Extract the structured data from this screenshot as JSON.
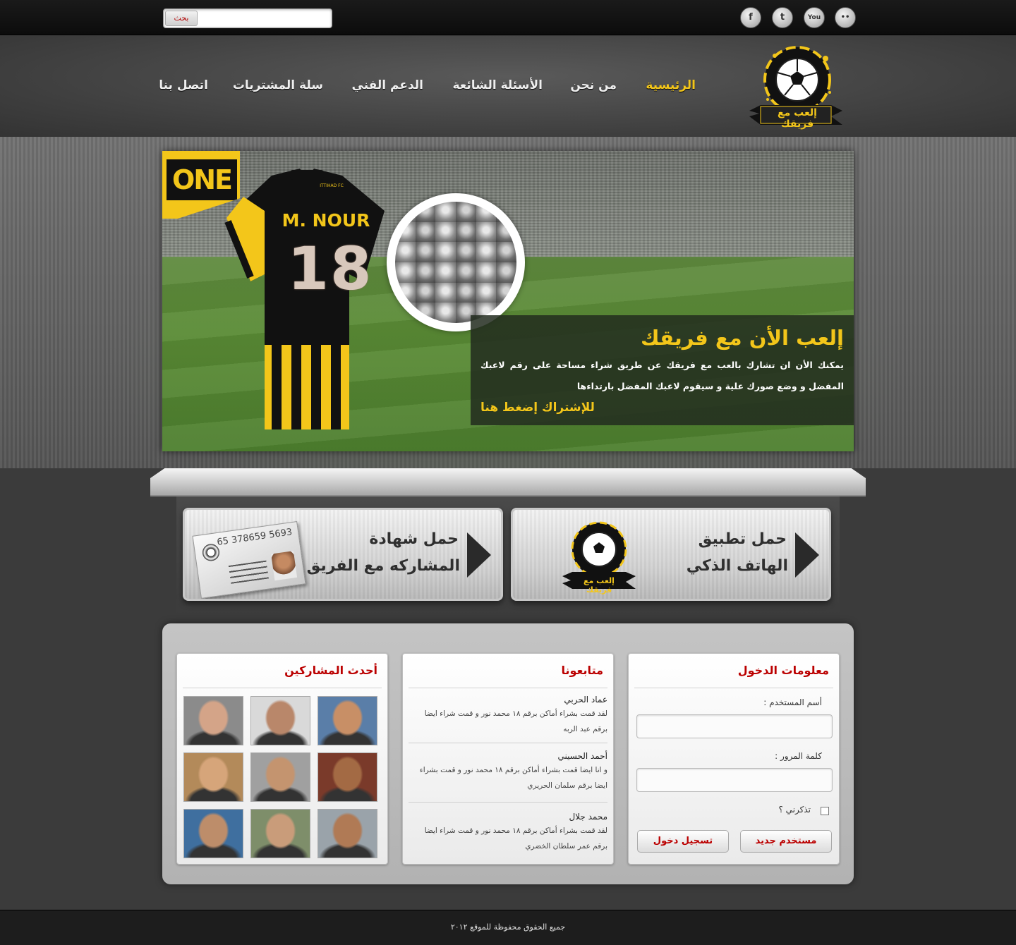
{
  "search": {
    "button_label": "بحث",
    "placeholder": ""
  },
  "social": [
    {
      "icon": "facebook-icon",
      "glyph": "f"
    },
    {
      "icon": "twitter-icon",
      "glyph": "t"
    },
    {
      "icon": "youtube-icon",
      "glyph": "You"
    },
    {
      "icon": "flickr-icon",
      "glyph": "••"
    }
  ],
  "nav": {
    "items": [
      {
        "label": "الرئيسية",
        "active": true
      },
      {
        "label": "من نحن"
      },
      {
        "label": "الأسئلة الشائعة"
      },
      {
        "label": "الدعم الفني"
      },
      {
        "label": "سلة المشتريات"
      },
      {
        "label": "اتصل بنا"
      }
    ]
  },
  "logo": {
    "text": "إلعب مع فريقك"
  },
  "hero": {
    "badge": "ONE",
    "shirt_name": "M. NOUR",
    "shirt_number": "18",
    "shirt_club": "ITTIHAD FC",
    "title": "إلعب الأن مع فريقك",
    "text": "يمكنك الأن ان تشارك بالعب مع فريقك عن طريق شراء مساحة على رقم لاعبك المفضل و وضع صورك علية و سيقوم لاعبك المفضل بارتداءها",
    "cta": "للإشتراك إضغط هنا"
  },
  "promos": {
    "app": {
      "line1": "حمل تطبيق",
      "line2": "الهاتف الذكي"
    },
    "certificate": {
      "line1": "حمل شهادة",
      "line2": "المشاركه مع الفريق",
      "card_number": "65 378659 5693"
    }
  },
  "login": {
    "title": "معلومات الدخول",
    "username_label": "أسم المستخدم :",
    "password_label": "كلمة المرور :",
    "remember_label": "تذكرني ؟",
    "login_button": "تسجيل دخول",
    "register_button": "مستخدم جديد"
  },
  "followers": {
    "title": "متابعونا",
    "items": [
      {
        "name": "عماد الحربي",
        "text": "لقد قمت بشراء أماكن برقم ١٨ محمد نور و قمت شراء ايضا برقم عبد الربه"
      },
      {
        "name": "أحمد الحسيني",
        "text": "و انا ايضا  قمت بشراء أماكن برقم ١٨ محمد نور و قمت بشراء ايضا برقم سلمان الحريري"
      },
      {
        "name": "محمد جلال",
        "text": "لقد قمت بشراء أماكن برقم ١٨ محمد نور و قمت شراء ايضا برقم عمر سلطان الخضري"
      }
    ]
  },
  "participants": {
    "title": "أحدث المشاركين",
    "avatars": [
      {
        "skin": "#c88f66",
        "bg": "#5a7ea8"
      },
      {
        "skin": "#b9876a",
        "bg": "#d9d9d9"
      },
      {
        "skin": "#d4a488",
        "bg": "#8b8b8b"
      },
      {
        "skin": "#a36a44",
        "bg": "#7a3a2a"
      },
      {
        "skin": "#c4946f",
        "bg": "#a0a0a0"
      },
      {
        "skin": "#d6a57a",
        "bg": "#b38a5a"
      },
      {
        "skin": "#b07a55",
        "bg": "#9aa3aa"
      },
      {
        "skin": "#c99c7a",
        "bg": "#7e8e6a"
      },
      {
        "skin": "#bd8d6a",
        "bg": "#3f6f9f"
      }
    ]
  },
  "footer": {
    "text": "جميع الحقوق محفوظة للموقع ٢٠١٢"
  },
  "colors": {
    "accent": "#f3c61a",
    "link_red": "#bb0000"
  }
}
